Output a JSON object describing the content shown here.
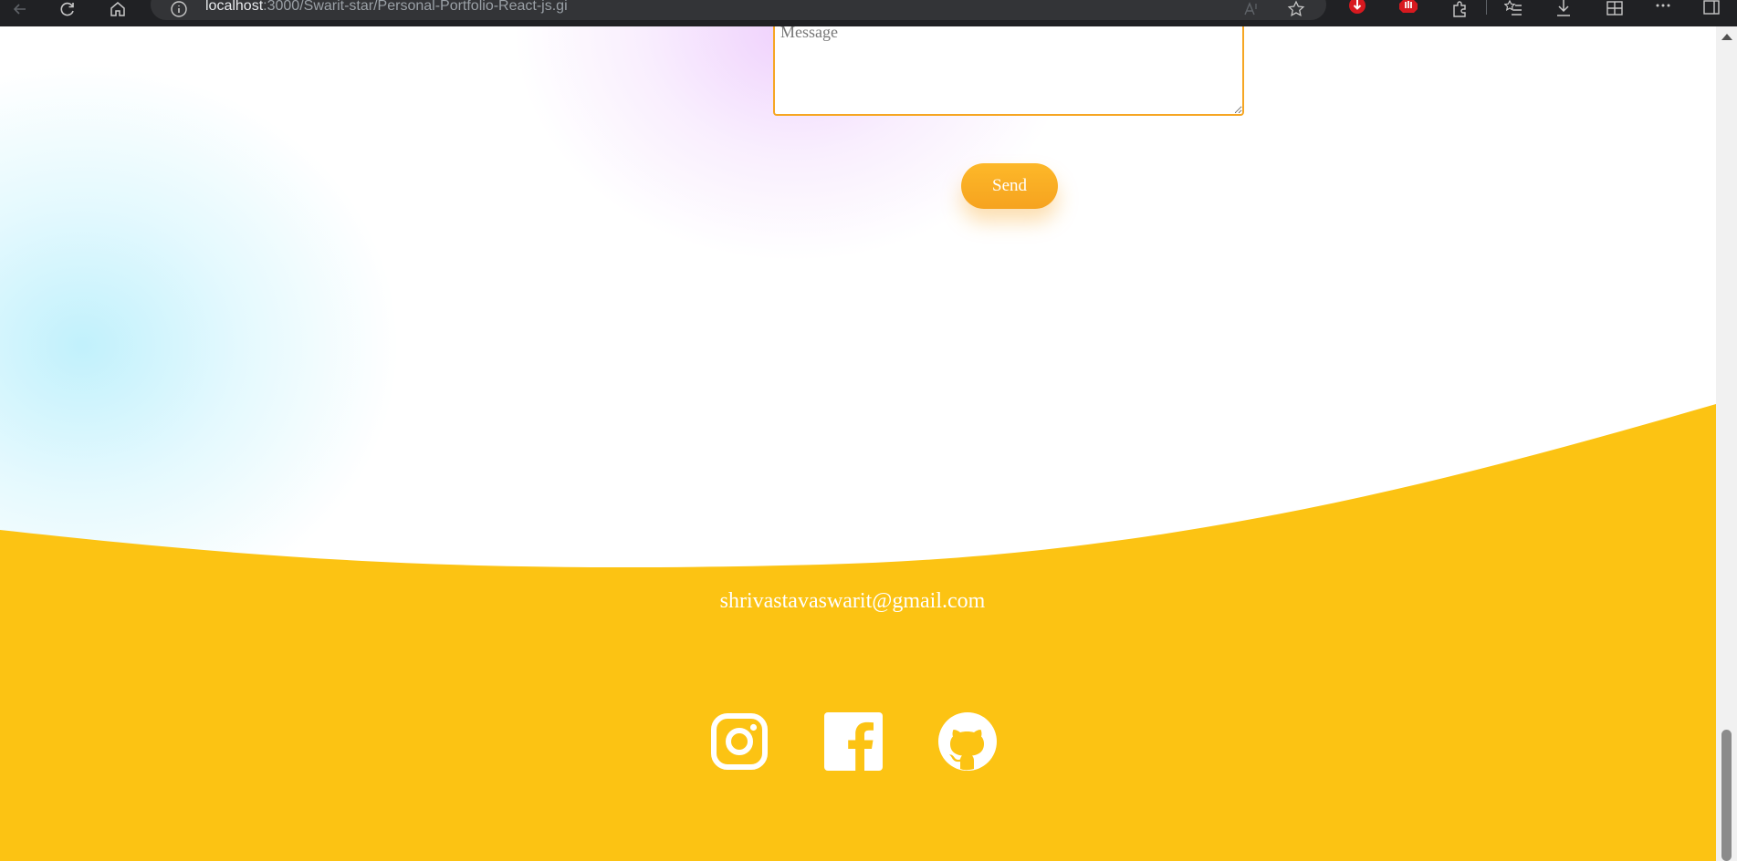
{
  "browser": {
    "url_host": "localhost",
    "url_path": ":3000/Swarit-star/Personal-Portfolio-React-js.gi",
    "icons": [
      "back-icon",
      "refresh-icon",
      "home-icon",
      "site-info-icon",
      "read-aloud-icon",
      "favorite-star-icon",
      "extension-download-icon",
      "extension-stop-icon",
      "extensions-puzzle-icon",
      "favorites-icon",
      "downloads-icon",
      "collections-icon",
      "more-icon",
      "sidebar-icon"
    ]
  },
  "contact_form": {
    "message_placeholder": "Message",
    "send_label": "Send"
  },
  "footer": {
    "email": "shrivastavaswarit@gmail.com",
    "social": [
      "instagram-icon",
      "facebook-icon",
      "github-icon"
    ]
  },
  "colors": {
    "accent": "#fcc313",
    "button": "#f9ae24",
    "input_border": "#f6a623"
  }
}
